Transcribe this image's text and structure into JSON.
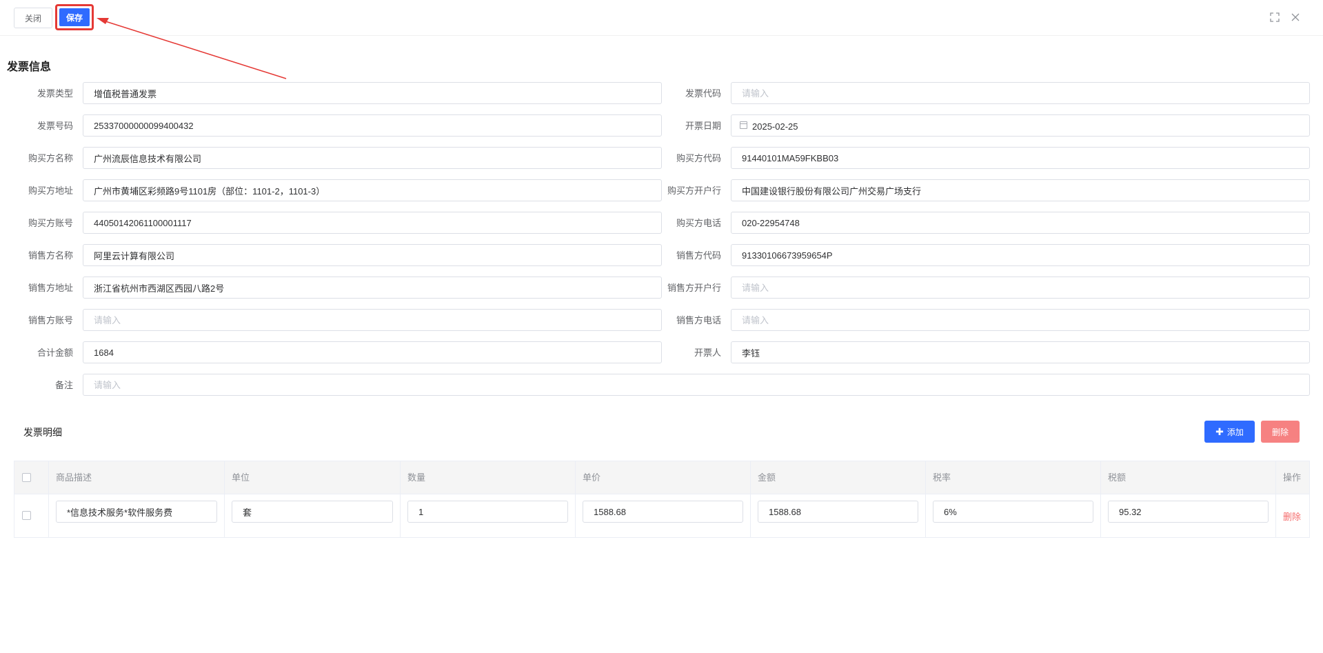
{
  "toolbar": {
    "close_label": "关闭",
    "save_label": "保存"
  },
  "section_title": "发票信息",
  "form": {
    "invoice_type": {
      "label": "发票类型",
      "value": "增值税普通发票"
    },
    "invoice_code": {
      "label": "发票代码",
      "value": "",
      "placeholder": "请输入"
    },
    "invoice_number": {
      "label": "发票号码",
      "value": "25337000000099400432"
    },
    "issue_date": {
      "label": "开票日期",
      "value": "2025-02-25"
    },
    "buyer_name": {
      "label": "购买方名称",
      "value": "广州流辰信息技术有限公司"
    },
    "buyer_code": {
      "label": "购买方代码",
      "value": "91440101MA59FKBB03"
    },
    "buyer_address": {
      "label": "购买方地址",
      "value": "广州市黄埔区彩频路9号1101房（部位：1101-2，1101-3）"
    },
    "buyer_bank": {
      "label": "购买方开户行",
      "value": "中国建设银行股份有限公司广州交易广场支行"
    },
    "buyer_account": {
      "label": "购买方账号",
      "value": "44050142061100001117"
    },
    "buyer_phone": {
      "label": "购买方电话",
      "value": "020-22954748"
    },
    "seller_name": {
      "label": "销售方名称",
      "value": "阿里云计算有限公司"
    },
    "seller_code": {
      "label": "销售方代码",
      "value": "91330106673959654P"
    },
    "seller_address": {
      "label": "销售方地址",
      "value": "浙江省杭州市西湖区西园八路2号"
    },
    "seller_bank": {
      "label": "销售方开户行",
      "value": "",
      "placeholder": "请输入"
    },
    "seller_account": {
      "label": "销售方账号",
      "value": "",
      "placeholder": "请输入"
    },
    "seller_phone": {
      "label": "销售方电话",
      "value": "",
      "placeholder": "请输入"
    },
    "total_amount": {
      "label": "合计金额",
      "value": "1684"
    },
    "drawer": {
      "label": "开票人",
      "value": "李钰"
    },
    "remark": {
      "label": "备注",
      "value": "",
      "placeholder": "请输入"
    }
  },
  "detail": {
    "title": "发票明细",
    "add_label": "添加",
    "delete_label": "删除",
    "columns": [
      "商品描述",
      "单位",
      "数量",
      "单价",
      "金额",
      "税率",
      "税额",
      "操作"
    ],
    "rows": [
      {
        "desc": "*信息技术服务*软件服务费",
        "unit": "套",
        "qty": "1",
        "price": "1588.68",
        "amount": "1588.68",
        "rate": "6%",
        "tax": "95.32",
        "action": "删除"
      }
    ]
  },
  "colors": {
    "primary": "#2f6bff",
    "danger": "#f56c6c",
    "highlight": "#e53935"
  }
}
